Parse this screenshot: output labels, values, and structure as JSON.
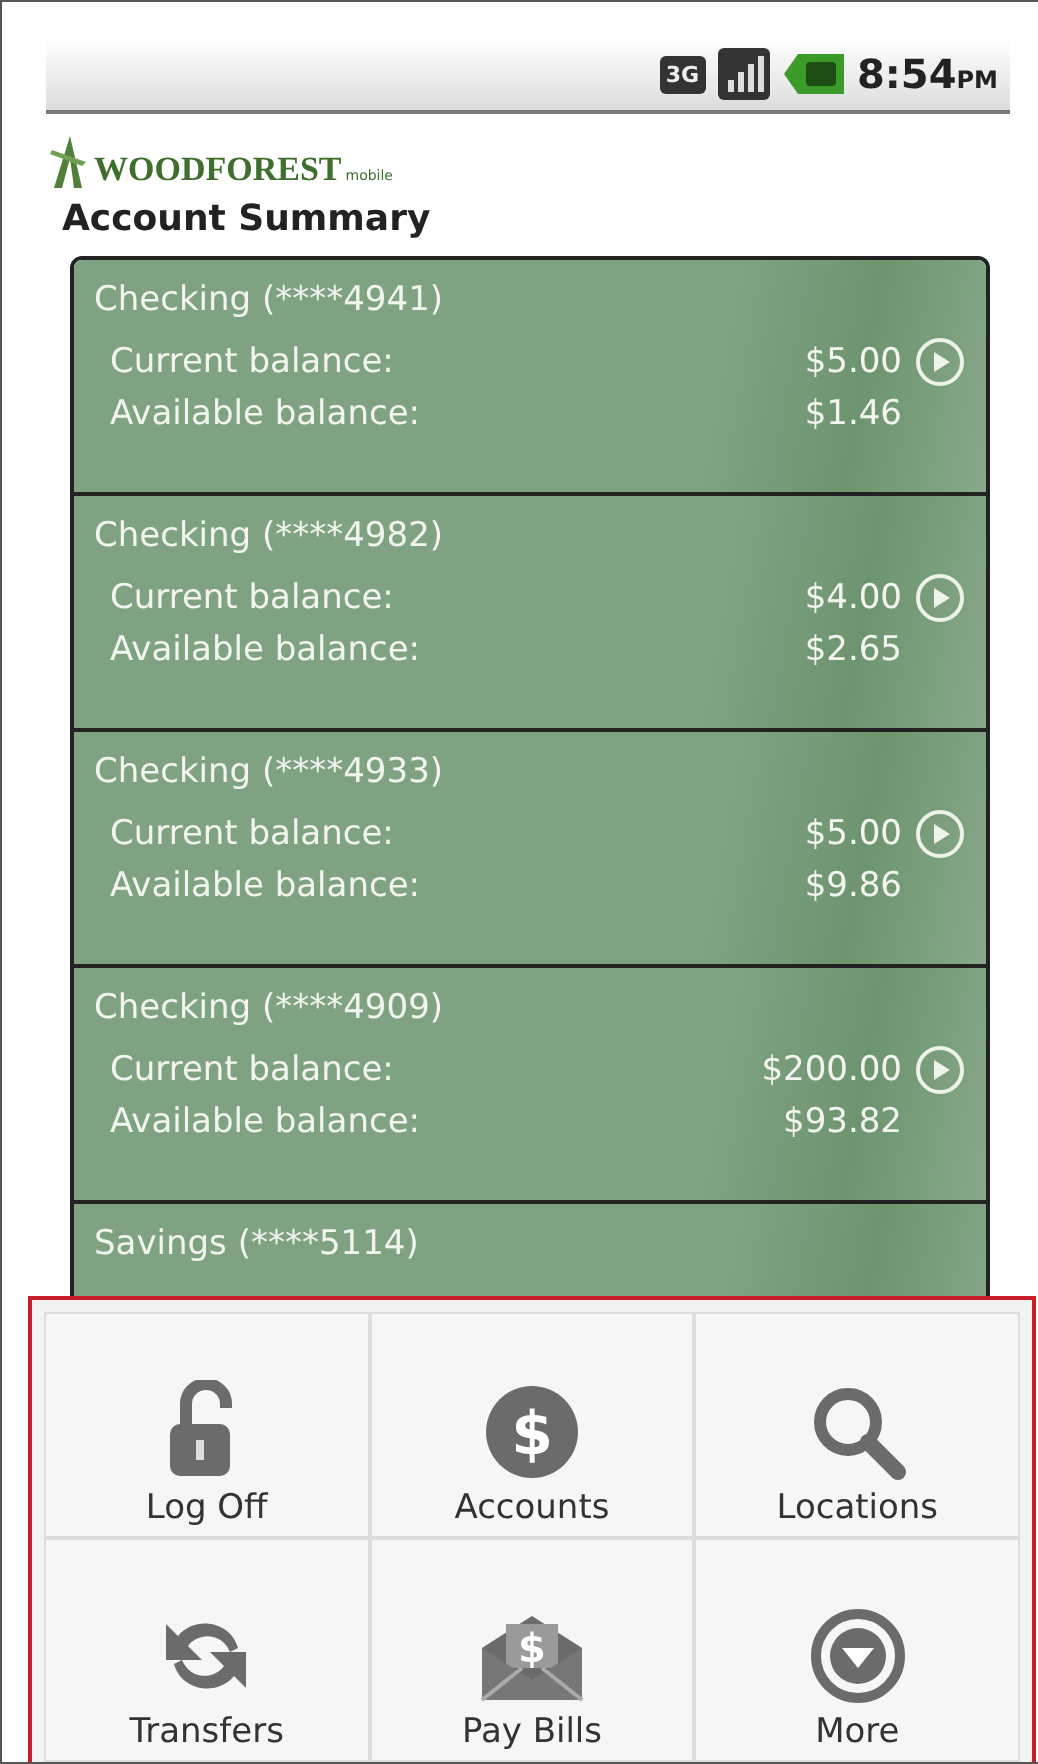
{
  "status_bar": {
    "network": "3G",
    "time": "8:54",
    "ampm": "PM"
  },
  "header": {
    "brand": "WOODFOREST",
    "brand_suffix": "mobile",
    "title": "Account Summary"
  },
  "accounts": [
    {
      "name": "Checking (****4941)",
      "current_label": "Current balance:",
      "current": "$5.00",
      "available_label": "Available balance:",
      "available": "$1.46"
    },
    {
      "name": "Checking (****4982)",
      "current_label": "Current balance:",
      "current": "$4.00",
      "available_label": "Available balance:",
      "available": "$2.65"
    },
    {
      "name": "Checking (****4933)",
      "current_label": "Current balance:",
      "current": "$5.00",
      "available_label": "Available balance:",
      "available": "$9.86"
    },
    {
      "name": "Checking (****4909)",
      "current_label": "Current balance:",
      "current": "$200.00",
      "available_label": "Available balance:",
      "available": "$93.82"
    },
    {
      "name": "Savings (****5114)"
    }
  ],
  "menu": [
    {
      "label": "Log Off",
      "kind": "lock"
    },
    {
      "label": "Accounts",
      "kind": "dollar",
      "glyph": "$"
    },
    {
      "label": "Locations",
      "kind": "search"
    },
    {
      "label": "Transfers",
      "kind": "transfer"
    },
    {
      "label": "Pay Bills",
      "kind": "envelope",
      "glyph": "$"
    },
    {
      "label": "More",
      "kind": "more"
    }
  ]
}
